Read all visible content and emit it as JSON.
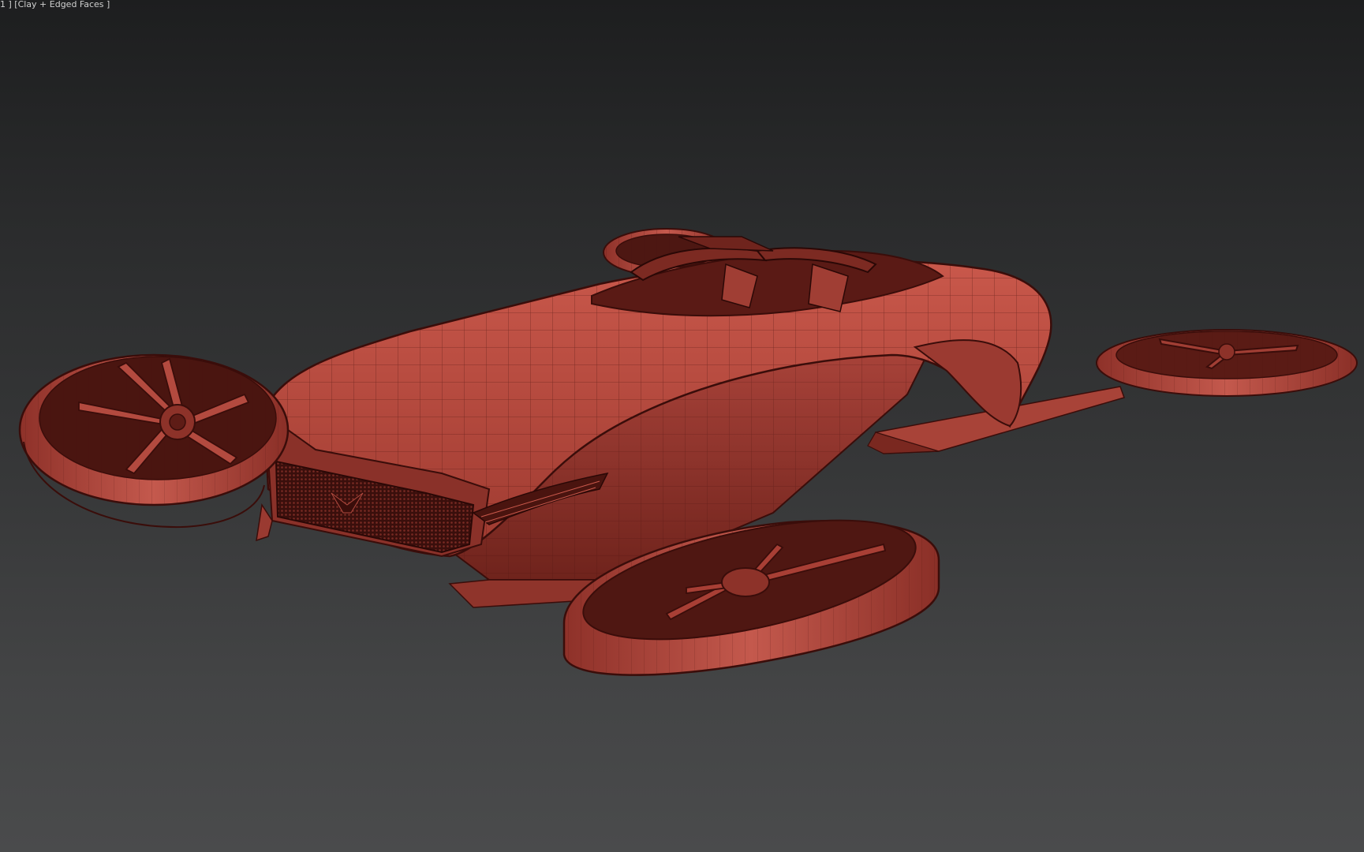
{
  "viewport": {
    "label": "1 ] [Clay + Edged Faces ]",
    "shading_mode": "Clay + Edged Faces",
    "background_colors": [
      "#1d1e1f",
      "#4a4b4c"
    ],
    "model_color": "#b8473c",
    "edge_color": "#3a0d0a"
  }
}
